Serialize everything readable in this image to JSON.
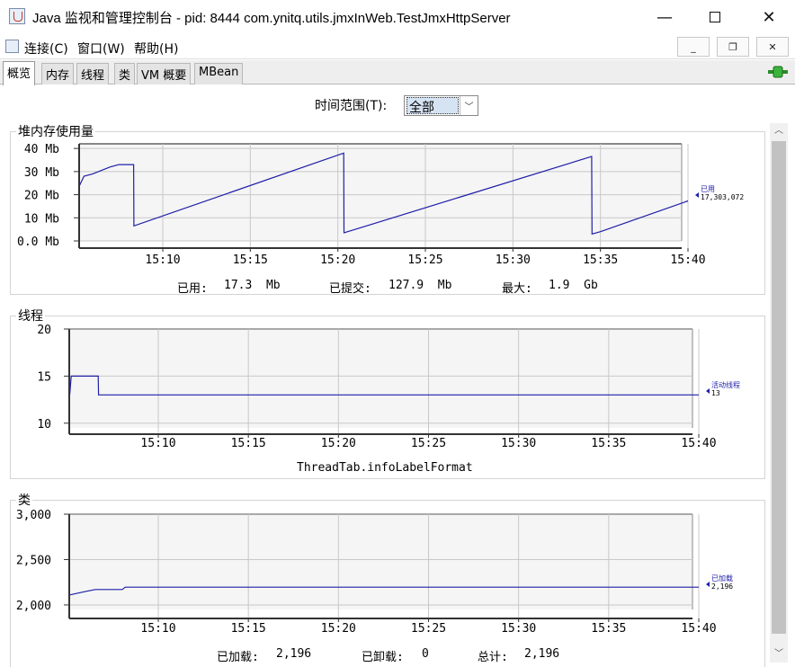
{
  "window": {
    "title": "Java 监视和管理控制台 - pid: 8444 com.ynitq.utils.jmxInWeb.TestJmxHttpServer",
    "minimize": "—",
    "close": "✕"
  },
  "menu": {
    "items": [
      "连接(C)",
      "窗口(W)",
      "帮助(H)"
    ],
    "mdi_minimize": "_",
    "mdi_restore": "❐",
    "mdi_close": "✕"
  },
  "tabs": [
    "概览",
    "内存",
    "线程",
    "类",
    "VM 概要",
    "MBean"
  ],
  "active_tab": "概览",
  "time_range": {
    "label": "时间范围(T):",
    "value": "全部"
  },
  "colors": {
    "series": "#1f1fa8",
    "grid": "#c8c8c8",
    "plot_bg": "#f5f5f5"
  },
  "heap_panel": {
    "title": "堆内存使用量",
    "stats": {
      "used_label": "已用:",
      "used": "17.3  Mb",
      "committed_label": "已提交:",
      "committed": "127.9  Mb",
      "max_label": "最大:",
      "max": "1.9  Gb"
    },
    "legend": {
      "name": "已用",
      "value": "17,303,072"
    }
  },
  "thread_panel": {
    "title": "线程",
    "footer": "ThreadTab.infoLabelFormat",
    "legend": {
      "name": "活动线程",
      "value": "13"
    }
  },
  "class_panel": {
    "title": "类",
    "stats": {
      "loaded_label": "已加载:",
      "loaded": "2,196",
      "unloaded_label": "已卸载:",
      "unloaded": "0",
      "total_label": "总计:",
      "total": "2,196"
    },
    "legend": {
      "name": "已加载",
      "value": "2,196"
    }
  },
  "chart_data": [
    {
      "type": "line",
      "title": "堆内存使用量",
      "x_ticks": [
        "15:10",
        "15:15",
        "15:20",
        "15:25",
        "15:30",
        "15:35",
        "15:40"
      ],
      "y_ticks": [
        "0.0 Mb",
        "10 Mb",
        "20 Mb",
        "30 Mb",
        "40 Mb"
      ],
      "ylim": [
        0,
        42
      ],
      "series": [
        {
          "name": "已用",
          "x": [
            "15:05:15",
            "15:05:30",
            "15:06:00",
            "15:07:00",
            "15:07:30",
            "15:08:00",
            "15:08:20",
            "15:08:21",
            "15:20:20",
            "15:20:21",
            "15:34:30",
            "15:34:31",
            "15:35:00",
            "15:40:00"
          ],
          "values": [
            24,
            28,
            29,
            32,
            33,
            33,
            33,
            6.5,
            38,
            3.5,
            36.5,
            3,
            4,
            17.3
          ]
        }
      ]
    },
    {
      "type": "line",
      "title": "线程",
      "x_ticks": [
        "15:10",
        "15:15",
        "15:20",
        "15:25",
        "15:30",
        "15:35",
        "15:40"
      ],
      "y_ticks": [
        "10",
        "15",
        "20"
      ],
      "ylim": [
        9.5,
        20
      ],
      "series": [
        {
          "name": "活动线程",
          "x": [
            "15:05:05",
            "15:05:10",
            "15:06:40",
            "15:06:41",
            "15:40:00"
          ],
          "values": [
            13,
            15,
            15,
            13,
            13
          ]
        }
      ]
    },
    {
      "type": "line",
      "title": "类",
      "x_ticks": [
        "15:10",
        "15:15",
        "15:20",
        "15:25",
        "15:30",
        "15:35",
        "15:40"
      ],
      "y_ticks": [
        "2,000",
        "2,500",
        "3,000"
      ],
      "ylim": [
        1950,
        3000
      ],
      "series": [
        {
          "name": "已加载",
          "x": [
            "15:05:05",
            "15:06:00",
            "15:06:30",
            "15:08:00",
            "15:08:10",
            "15:40:00"
          ],
          "values": [
            2110,
            2150,
            2170,
            2170,
            2196,
            2196
          ]
        }
      ]
    }
  ]
}
